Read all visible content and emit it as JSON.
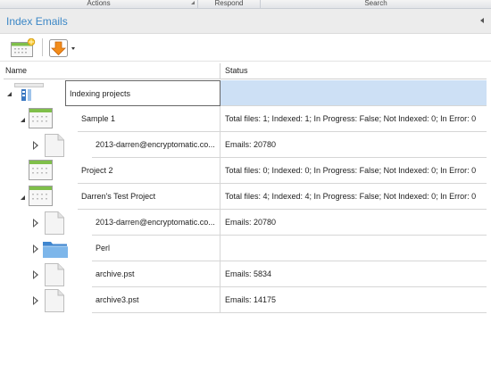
{
  "ribbon": {
    "groups": [
      "Actions",
      "Respond",
      "Search"
    ]
  },
  "pane": {
    "title": "Index Emails"
  },
  "toolbar": {
    "new_project_icon": "new-project-icon",
    "download_icon": "download-arrow-icon"
  },
  "tree": {
    "columns": {
      "name": "Name",
      "status": "Status"
    },
    "rows": [
      {
        "name": "Indexing projects",
        "status": "",
        "expander": "open",
        "icon": "indexing-root-icon",
        "selected": true
      },
      {
        "name": "Sample 1",
        "status": "Total files: 1; Indexed: 1; In Progress: False; Not Indexed: 0; In Error: 0",
        "expander": "open",
        "icon": "project-icon"
      },
      {
        "name": "2013-darren@encryptomatic.co...",
        "status": "Emails: 20780",
        "expander": "closed",
        "icon": "document-icon"
      },
      {
        "name": "Project 2",
        "status": "Total files: 0; Indexed: 0; In Progress: False; Not Indexed: 0; In Error: 0",
        "expander": "none",
        "icon": "project-icon"
      },
      {
        "name": "Darren's Test Project",
        "status": "Total files: 4; Indexed: 4; In Progress: False; Not Indexed: 0; In Error: 0",
        "expander": "open",
        "icon": "project-icon"
      },
      {
        "name": "2013-darren@encryptomatic.co...",
        "status": "Emails: 20780",
        "expander": "closed",
        "icon": "document-icon"
      },
      {
        "name": "Perl",
        "status": "",
        "expander": "closed",
        "icon": "folder-icon"
      },
      {
        "name": "archive.pst",
        "status": "Emails: 5834",
        "expander": "closed",
        "icon": "document-icon"
      },
      {
        "name": "archive3.pst",
        "status": "Emails: 14175",
        "expander": "closed",
        "icon": "document-icon"
      }
    ]
  }
}
